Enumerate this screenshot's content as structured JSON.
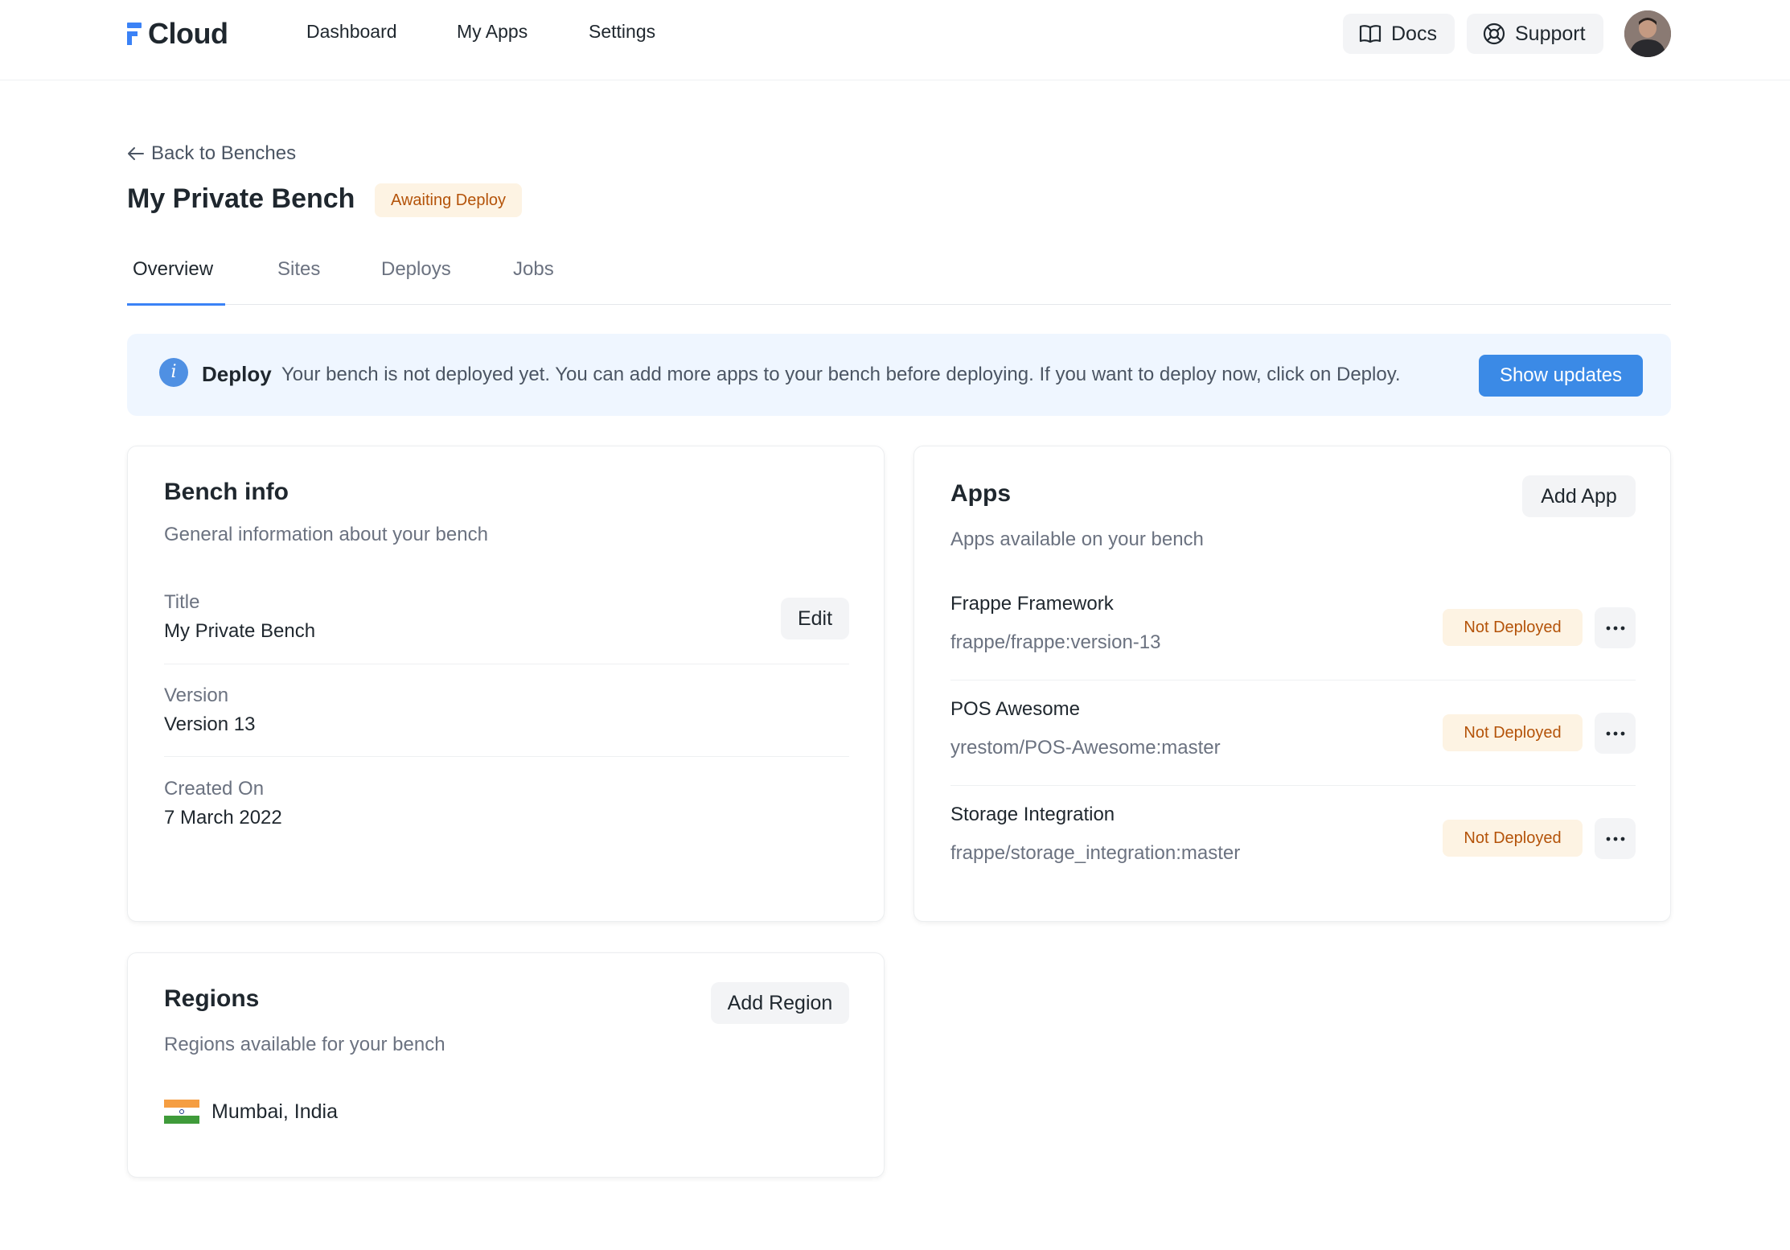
{
  "brand": {
    "name": "Cloud",
    "accent": "#3b82f6"
  },
  "nav": {
    "links": [
      "Dashboard",
      "My Apps",
      "Settings"
    ],
    "docs_label": "Docs",
    "support_label": "Support"
  },
  "header": {
    "back_label": "Back to Benches",
    "title": "My Private Bench",
    "status_badge": "Awaiting Deploy"
  },
  "tabs": [
    "Overview",
    "Sites",
    "Deploys",
    "Jobs"
  ],
  "alert": {
    "title": "Deploy",
    "message": "Your bench is not deployed yet. You can add more apps to your bench before deploying. If you want to deploy now, click on Deploy.",
    "button_label": "Show updates"
  },
  "bench_info": {
    "title": "Bench info",
    "subtitle": "General information about your bench",
    "edit_label": "Edit",
    "fields": [
      {
        "label": "Title",
        "value": "My Private Bench"
      },
      {
        "label": "Version",
        "value": "Version 13"
      },
      {
        "label": "Created On",
        "value": "7 March 2022"
      }
    ]
  },
  "apps": {
    "title": "Apps",
    "subtitle": "Apps available on your bench",
    "add_label": "Add App",
    "items": [
      {
        "name": "Frappe Framework",
        "repo": "frappe/frappe:version-13",
        "status": "Not Deployed"
      },
      {
        "name": "POS Awesome",
        "repo": "yrestom/POS-Awesome:master",
        "status": "Not Deployed"
      },
      {
        "name": "Storage Integration",
        "repo": "frappe/storage_integration:master",
        "status": "Not Deployed"
      }
    ]
  },
  "regions": {
    "title": "Regions",
    "subtitle": "Regions available for your bench",
    "add_label": "Add Region",
    "items": [
      {
        "name": "Mumbai, India",
        "flag_icon": "india-flag-icon"
      }
    ]
  }
}
